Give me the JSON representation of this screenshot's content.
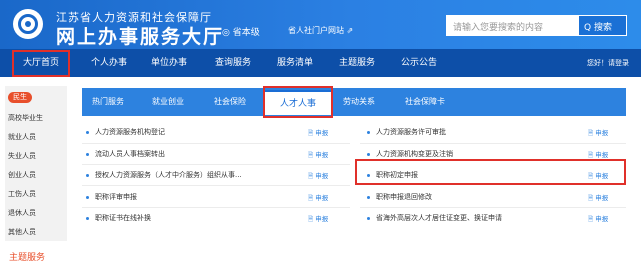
{
  "header": {
    "org_name": "江苏省人力资源和社会保障厅",
    "site_title": "网上办事服务大厅",
    "location": "◎ 省本级",
    "portal_link": "省人社门户网站 ⇗",
    "search_placeholder": "请输入您要搜索的内容",
    "search_button": "Q 搜索"
  },
  "nav": {
    "items": [
      "大厅首页",
      "个人办事",
      "单位办事",
      "查询服务",
      "服务清单",
      "主题服务",
      "公示公告"
    ],
    "login": "您好！请登录"
  },
  "sidebar": {
    "badge": "民生",
    "items": [
      "高校毕业生",
      "就业人员",
      "失业人员",
      "创业人员",
      "工伤人员",
      "退休人员",
      "其他人员"
    ]
  },
  "tabs": [
    "热门服务",
    "就业创业",
    "社会保险",
    "人才人事",
    "劳动关系",
    "社会保障卡"
  ],
  "active_tab": "人才人事",
  "services": {
    "apply_label": "🗎 申报",
    "left": [
      "人力资源服务机构登记",
      "流动人员人事档案转出",
      "授权人力资源服务（人才中介服务）组织从事...",
      "职称评审申报",
      "职称证书在线补换"
    ],
    "right": [
      "人力资源服务许可审批",
      "人力资源机构变更及注销",
      "职称初定申报",
      "职称申报退回修改",
      "省海外高层次人才居住证变更、换证申请"
    ]
  },
  "section_title": "主题服务"
}
